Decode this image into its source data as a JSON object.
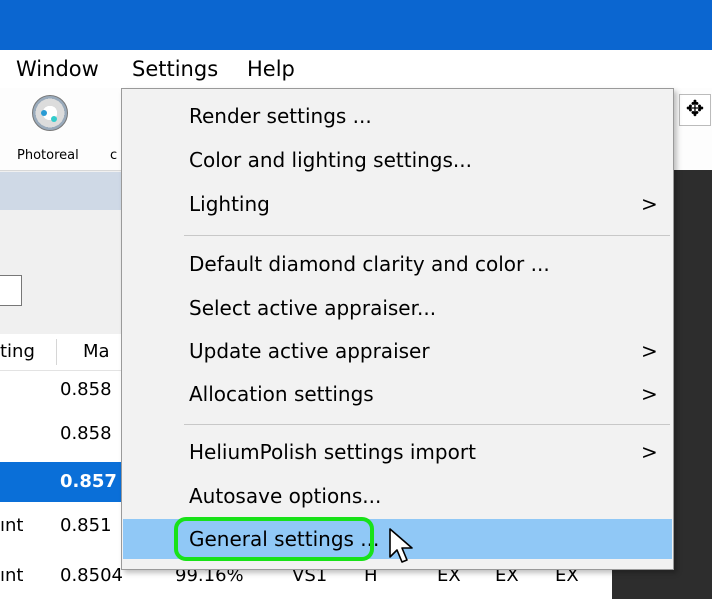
{
  "menubar": {
    "window": "Window",
    "settings": "Settings",
    "help": "Help"
  },
  "toolbar": {
    "photoreal": "Photoreal",
    "partial": "c"
  },
  "table": {
    "headers": [
      "ting",
      "Ma"
    ],
    "rows": [
      {
        "c1": "",
        "c2": "0.858"
      },
      {
        "c1": "",
        "c2": "0.858"
      },
      {
        "c1": "",
        "c2": "0.857",
        "selected": true
      },
      {
        "c1": "ınt",
        "c2": "0.851"
      },
      {
        "c1": "ınt",
        "c2": "0.8504",
        "c3": "99.16%",
        "c4": "VS1",
        "c5": "H",
        "c6": "EX",
        "c7": "EX",
        "c8": "EX"
      }
    ]
  },
  "settings_menu": {
    "items": [
      {
        "label": "Render settings ...",
        "submenu": false
      },
      {
        "label": "Color and lighting settings...",
        "submenu": false
      },
      {
        "label": "Lighting",
        "submenu": true
      },
      {
        "label": "Default diamond clarity and color ...",
        "submenu": false
      },
      {
        "label": "Select active appraiser...",
        "submenu": false
      },
      {
        "label": "Update active appraiser",
        "submenu": true
      },
      {
        "label": "Allocation settings",
        "submenu": true
      },
      {
        "label": "HeliumPolish settings import",
        "submenu": true
      },
      {
        "label": "Autosave options...",
        "submenu": false
      },
      {
        "label": "General settings ...",
        "submenu": false,
        "hovered": true
      }
    ],
    "submenu_arrow": ">"
  },
  "icons": {
    "right_toolbar": "move-arrows-icon",
    "cursor": "mouse-pointer-icon"
  },
  "colors": {
    "titlebar": "#0b66d0",
    "highlight_ring": "#18e218",
    "hover": "#90c8f6",
    "selection": "#0a6fd8"
  }
}
